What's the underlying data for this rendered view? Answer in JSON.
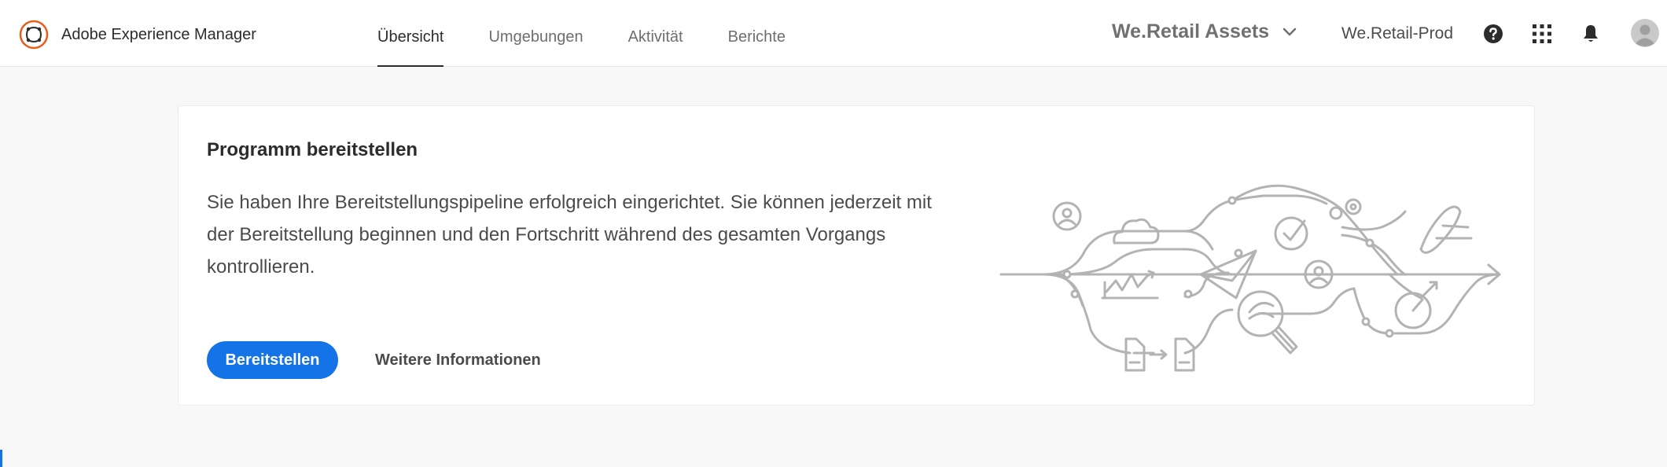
{
  "header": {
    "app_title": "Adobe Experience Manager",
    "tabs": [
      {
        "label": "Übersicht",
        "active": true
      },
      {
        "label": "Umgebungen",
        "active": false
      },
      {
        "label": "Aktivität",
        "active": false
      },
      {
        "label": "Berichte",
        "active": false
      }
    ],
    "org_selector": "We.Retail Assets",
    "environment": "We.Retail-Prod",
    "icons": [
      "help-icon",
      "apps-grid-icon",
      "notification-bell-icon",
      "avatar-icon"
    ],
    "active_tab_underline_color": "#2c2c2c",
    "logo_color": "#e85d1a"
  },
  "card": {
    "title": "Programm bereitstellen",
    "description": "Sie haben Ihre Bereitstellungspipeline erfolgreich eingerichtet. Sie können jederzeit mit der Bereitstellung beginnen und den Fortschritt während des gesamten Vorgangs kontrollieren.",
    "primary_button": "Bereitstellen",
    "secondary_button": "Weitere Informationen",
    "primary_color": "#1473e6",
    "illustration": "deployment-pipeline-illustration"
  }
}
